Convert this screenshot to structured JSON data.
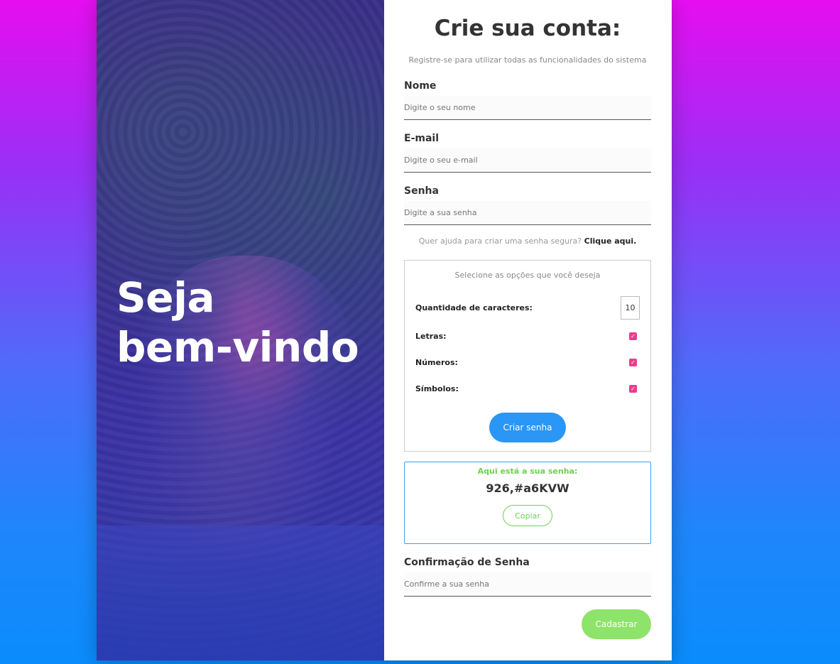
{
  "hero": {
    "line1": "Seja",
    "line2": "bem-vindo"
  },
  "form": {
    "title": "Crie sua conta:",
    "subtitle": "Registre-se para utilizar todas as funcionalidades do sistema",
    "name": {
      "label": "Nome",
      "placeholder": "Digite o seu nome"
    },
    "email": {
      "label": "E-mail",
      "placeholder": "Digite o seu e-mail"
    },
    "password": {
      "label": "Senha",
      "placeholder": "Digite a sua senha"
    },
    "help": {
      "text": "Quer ajuda para criar uma senha segura?",
      "link": "Clique aqui."
    },
    "confirm": {
      "label": "Confirmação de Senha",
      "placeholder": "Confirme a sua senha"
    },
    "submit_label": "Cadastrar"
  },
  "generator": {
    "title": "Selecione as opções que você deseja",
    "length_label": "Quantidade de caracteres:",
    "length_value": "10",
    "letters_label": "Letras:",
    "numbers_label": "Números:",
    "symbols_label": "Símbolos:",
    "letters_checked": true,
    "numbers_checked": true,
    "symbols_checked": true,
    "create_label": "Criar senha",
    "check_mark": "✓"
  },
  "result": {
    "label": "Aqui está a sua senha:",
    "value": "926,#a6KVW",
    "copy_label": "Copiar"
  },
  "colors": {
    "primary": "#2a96f6",
    "success": "#6bd34b",
    "checkbox": "#e83e8c",
    "submit": "#8ee36a"
  }
}
